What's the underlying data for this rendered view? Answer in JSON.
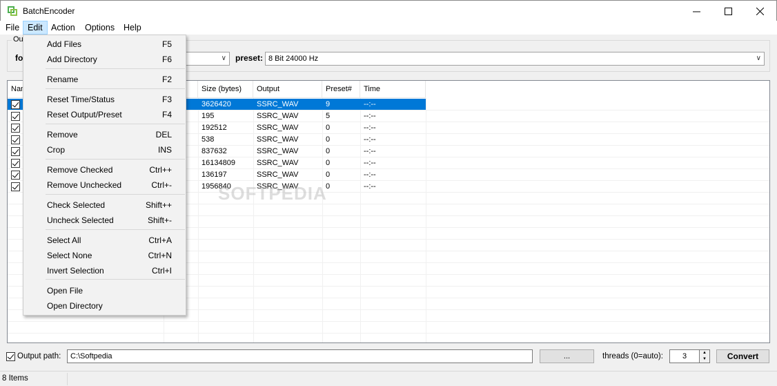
{
  "window": {
    "title": "BatchEncoder",
    "min_icon": "minimize-icon",
    "max_icon": "maximize-icon",
    "close_icon": "close-icon"
  },
  "menubar": [
    "File",
    "Edit",
    "Action",
    "Options",
    "Help"
  ],
  "output_group": {
    "label": "Out",
    "format_label": "fo",
    "preset_label": "preset:",
    "preset_value": "8 Bit 24000 Hz"
  },
  "listview": {
    "columns": [
      "Nam",
      "Size (bytes)",
      "Output",
      "Preset#",
      "Time"
    ],
    "rows": [
      {
        "checked": true,
        "size": "3626420",
        "output": "SSRC_WAV",
        "preset": "9",
        "time": "--:--",
        "selected": true
      },
      {
        "checked": true,
        "size": "195",
        "output": "SSRC_WAV",
        "preset": "5",
        "time": "--:--"
      },
      {
        "checked": true,
        "size": "192512",
        "output": "SSRC_WAV",
        "preset": "0",
        "time": "--:--"
      },
      {
        "checked": true,
        "size": "538",
        "output": "SSRC_WAV",
        "preset": "0",
        "time": "--:--"
      },
      {
        "checked": true,
        "size": "837632",
        "output": "SSRC_WAV",
        "preset": "0",
        "time": "--:--"
      },
      {
        "checked": true,
        "size": "16134809",
        "output": "SSRC_WAV",
        "preset": "0",
        "time": "--:--"
      },
      {
        "checked": true,
        "size": "136197",
        "output": "SSRC_WAV",
        "preset": "0",
        "time": "--:--"
      },
      {
        "checked": true,
        "size": "1956840",
        "output": "SSRC_WAV",
        "preset": "0",
        "time": "--:--"
      }
    ],
    "watermark": "SOFTPEDIA"
  },
  "bottom": {
    "output_path_label": "Output path:",
    "output_path_value": "C:\\Softpedia",
    "browse_label": "...",
    "threads_label": "threads (0=auto):",
    "threads_value": "3",
    "convert_label": "Convert"
  },
  "status": {
    "items": "8 Items"
  },
  "edit_menu": {
    "items": [
      {
        "label": "Add Files",
        "shortcut": "F5"
      },
      {
        "label": "Add Directory",
        "shortcut": "F6"
      },
      {
        "label": "Rename",
        "shortcut": "F2"
      },
      {
        "label": "Reset Time/Status",
        "shortcut": "F3"
      },
      {
        "label": "Reset Output/Preset",
        "shortcut": "F4"
      },
      {
        "label": "Remove",
        "shortcut": "DEL"
      },
      {
        "label": "Crop",
        "shortcut": "INS"
      },
      {
        "label": "Remove Checked",
        "shortcut": "Ctrl++"
      },
      {
        "label": "Remove Unchecked",
        "shortcut": "Ctrl+-"
      },
      {
        "label": "Check Selected",
        "shortcut": "Shift++"
      },
      {
        "label": "Uncheck Selected",
        "shortcut": "Shift+-"
      },
      {
        "label": "Select All",
        "shortcut": "Ctrl+A"
      },
      {
        "label": "Select None",
        "shortcut": "Ctrl+N"
      },
      {
        "label": "Invert Selection",
        "shortcut": "Ctrl+I"
      },
      {
        "label": "Open File",
        "shortcut": ""
      },
      {
        "label": "Open Directory",
        "shortcut": ""
      }
    ]
  },
  "colors": {
    "selection": "#0078d7",
    "menu_highlight": "#cce8ff",
    "app_icon": "#4caf50"
  }
}
